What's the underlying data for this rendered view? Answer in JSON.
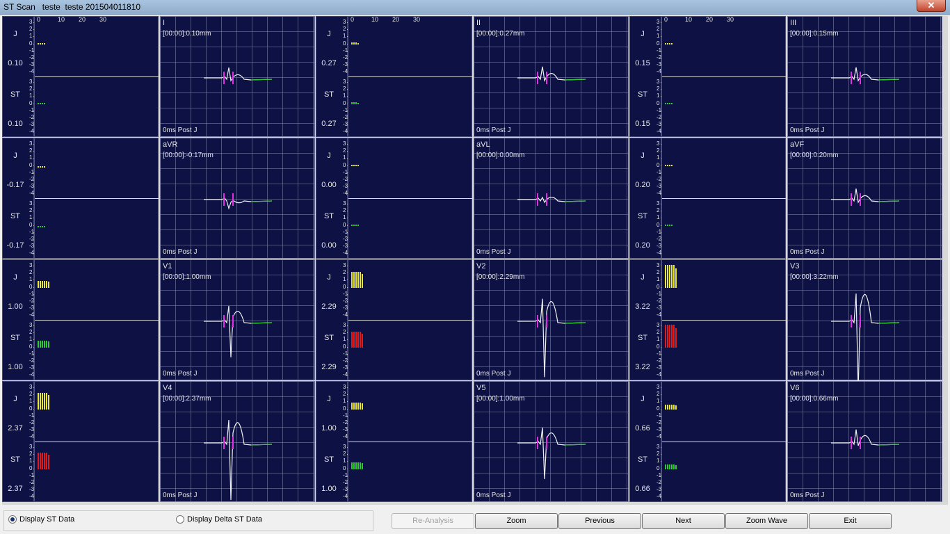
{
  "window": {
    "title": "ST Scan   teste  teste 201504011810",
    "close_label": "✕"
  },
  "trend_axis": {
    "ticks": [
      "3",
      "2",
      "1",
      "0",
      "-1",
      "-2",
      "-3",
      "-4"
    ],
    "x_ticks": [
      "0",
      "10",
      "20",
      "30"
    ],
    "j_label": "J",
    "st_label": "ST",
    "post_j": "0ms Post J"
  },
  "leads": [
    {
      "name": "I",
      "value_text": "[00:00]:0.10mm",
      "j_val": "0.10",
      "st_val": "0.10",
      "j": 0.1,
      "st": 0.1,
      "st_color": "#2ec92e",
      "j_color": "#e6e633"
    },
    {
      "name": "II",
      "value_text": "[00:00]:0.27mm",
      "j_val": "0.27",
      "st_val": "0.27",
      "j": 0.27,
      "st": 0.27,
      "st_color": "#2ec92e",
      "j_color": "#e6e633"
    },
    {
      "name": "III",
      "value_text": "[00:00]:0.15mm",
      "j_val": "0.15",
      "st_val": "0.15",
      "j": 0.15,
      "st": 0.15,
      "st_color": "#2ec92e",
      "j_color": "#e6e633"
    },
    {
      "name": "aVR",
      "value_text": "[00:00]:-0.17mm",
      "j_val": "-0.17",
      "st_val": "-0.17",
      "j": -0.17,
      "st": -0.17,
      "st_color": "#2ec92e",
      "j_color": "#e6e633"
    },
    {
      "name": "aVL",
      "value_text": "[00:00]:0.00mm",
      "j_val": "0.00",
      "st_val": "0.00",
      "j": 0.0,
      "st": 0.0,
      "st_color": "#2ec92e",
      "j_color": "#e6e633"
    },
    {
      "name": "aVF",
      "value_text": "[00:00]:0.20mm",
      "j_val": "0.20",
      "st_val": "0.20",
      "j": 0.2,
      "st": 0.2,
      "st_color": "#2ec92e",
      "j_color": "#e6e633"
    },
    {
      "name": "V1",
      "value_text": "[00:00]:1.00mm",
      "j_val": "1.00",
      "st_val": "1.00",
      "j": 1.0,
      "st": 1.0,
      "st_color": "#2ec92e",
      "j_color": "#e6e633"
    },
    {
      "name": "V2",
      "value_text": "[00:00]:2.29mm",
      "j_val": "2.29",
      "st_val": "2.29",
      "j": 2.29,
      "st": 2.29,
      "st_color": "#e01b1b",
      "j_color": "#e6e633"
    },
    {
      "name": "V3",
      "value_text": "[00:00]:3.22mm",
      "j_val": "3.22",
      "st_val": "3.22",
      "j": 3.22,
      "st": 3.22,
      "st_color": "#e01b1b",
      "j_color": "#e6e633"
    },
    {
      "name": "V4",
      "value_text": "[00:00]:2.37mm",
      "j_val": "2.37",
      "st_val": "2.37",
      "j": 2.37,
      "st": 2.37,
      "st_color": "#e01b1b",
      "j_color": "#e6e633"
    },
    {
      "name": "V5",
      "value_text": "[00:00]:1.00mm",
      "j_val": "1.00",
      "st_val": "1.00",
      "j": 1.0,
      "st": 1.0,
      "st_color": "#2ec92e",
      "j_color": "#e6e633"
    },
    {
      "name": "V6",
      "value_text": "[00:00]:0.66mm",
      "j_val": "0.66",
      "st_val": "0.66",
      "j": 0.66,
      "st": 0.66,
      "st_color": "#2ec92e",
      "j_color": "#e6e633"
    }
  ],
  "options": {
    "display_st": "Display ST Data",
    "display_delta": "Display Delta ST Data",
    "selected": "display_st"
  },
  "buttons": {
    "reanalysis": "Re-Analysis",
    "zoom": "Zoom",
    "previous": "Previous",
    "next": "Next",
    "zoom_wave": "Zoom Wave",
    "exit": "Exit"
  }
}
